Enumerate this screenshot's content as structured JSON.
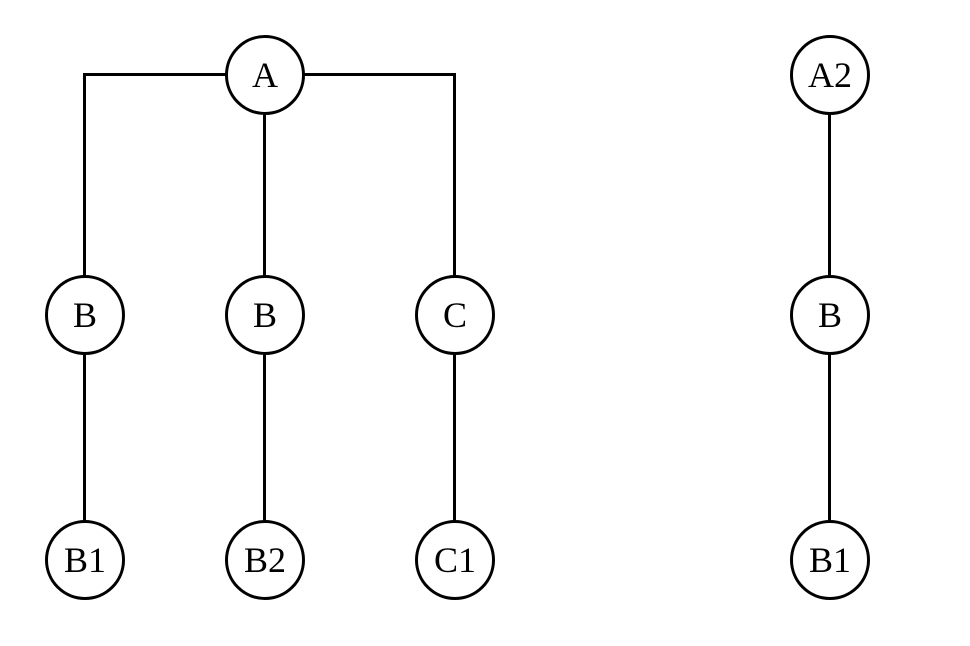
{
  "tree1": {
    "root": {
      "label": "A"
    },
    "level2": {
      "n1": {
        "label": "B"
      },
      "n2": {
        "label": "B"
      },
      "n3": {
        "label": "C"
      }
    },
    "level3": {
      "n1": {
        "label": "B1"
      },
      "n2": {
        "label": "B2"
      },
      "n3": {
        "label": "C1"
      }
    }
  },
  "tree2": {
    "root": {
      "label": "A2"
    },
    "level2": {
      "label": "B"
    },
    "level3": {
      "label": "B1"
    }
  }
}
